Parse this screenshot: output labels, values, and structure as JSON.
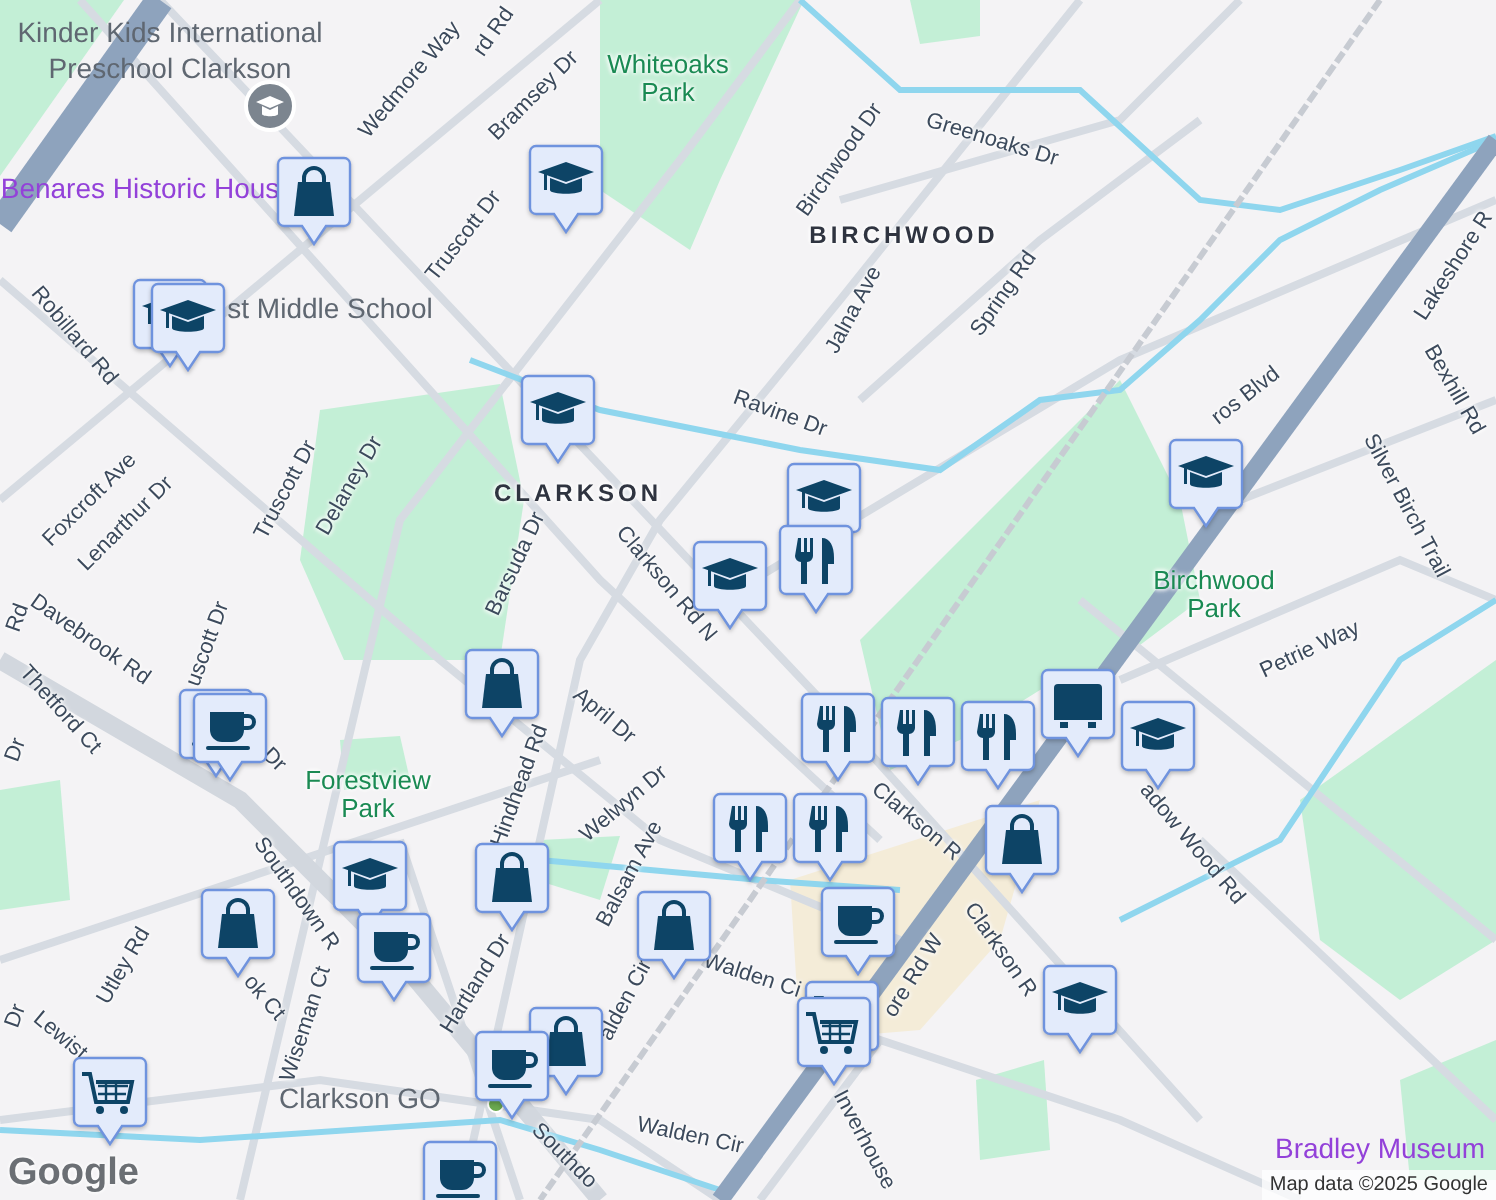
{
  "map": {
    "labels": [
      {
        "text": "Kinder Kids International Preschool Clarkson",
        "kind": "poi"
      },
      {
        "text": "rd Rd",
        "kind": "road"
      },
      {
        "text": "Wedmore Way",
        "kind": "road"
      },
      {
        "text": "Bramsey Dr",
        "kind": "road"
      },
      {
        "text": "Whiteoaks Park",
        "kind": "park"
      },
      {
        "text": "Benares Historic Hous",
        "kind": "landmark"
      },
      {
        "text": "Truscott Dr",
        "kind": "road"
      },
      {
        "text": "st Middle School",
        "kind": "poi"
      },
      {
        "text": "Robillard Rd",
        "kind": "road"
      },
      {
        "text": "Foxcroft Ave",
        "kind": "road"
      },
      {
        "text": "Lenarthur Dr",
        "kind": "road"
      },
      {
        "text": "Truscott Dr",
        "kind": "road"
      },
      {
        "text": "Delaney Dr",
        "kind": "road"
      },
      {
        "text": "CLARKSON",
        "kind": "area"
      },
      {
        "text": "Barsuda Dr",
        "kind": "road"
      },
      {
        "text": "Clarkson Rd N",
        "kind": "road"
      },
      {
        "text": "Birchwood Dr",
        "kind": "road"
      },
      {
        "text": "Greenoaks Dr",
        "kind": "road"
      },
      {
        "text": "BIRCHWOOD",
        "kind": "area"
      },
      {
        "text": "Jalna Ave",
        "kind": "road"
      },
      {
        "text": "Spring Rd",
        "kind": "road"
      },
      {
        "text": "Ravine Dr",
        "kind": "road"
      },
      {
        "text": "ros Blvd",
        "kind": "road"
      },
      {
        "text": "Lakeshore R",
        "kind": "road"
      },
      {
        "text": "Bexhill Rd",
        "kind": "road"
      },
      {
        "text": "Silver Birch Trail",
        "kind": "road"
      },
      {
        "text": "Birchwood Park",
        "kind": "park"
      },
      {
        "text": "Petrie Way",
        "kind": "road"
      },
      {
        "text": "Clarkson R",
        "kind": "road"
      },
      {
        "text": "adow Wood Rd",
        "kind": "road"
      },
      {
        "text": "ore Rd W",
        "kind": "road"
      },
      {
        "text": "Clarkson R",
        "kind": "road"
      },
      {
        "text": "Inverhouse",
        "kind": "road"
      },
      {
        "text": "Bradley Museum",
        "kind": "landmark"
      },
      {
        "text": "Rd",
        "kind": "road"
      },
      {
        "text": "Davebrook Rd",
        "kind": "road"
      },
      {
        "text": "uscott Dr",
        "kind": "road"
      },
      {
        "text": "Thetford Ct",
        "kind": "road"
      },
      {
        "text": "Dr",
        "kind": "road"
      },
      {
        "text": "Dr",
        "kind": "road"
      },
      {
        "text": "Forestview Park",
        "kind": "park"
      },
      {
        "text": "April Dr",
        "kind": "road"
      },
      {
        "text": "Hindhead Rd",
        "kind": "road"
      },
      {
        "text": "Welwyn Dr",
        "kind": "road"
      },
      {
        "text": "Southdown R",
        "kind": "road"
      },
      {
        "text": "Utley Rd",
        "kind": "road"
      },
      {
        "text": "ok Ct",
        "kind": "road"
      },
      {
        "text": "Wiseman Ct",
        "kind": "road"
      },
      {
        "text": "Hartland Dr",
        "kind": "road"
      },
      {
        "text": "Balsam Ave",
        "kind": "road"
      },
      {
        "text": "alden Cir",
        "kind": "road"
      },
      {
        "text": "Walden Ci",
        "kind": "road"
      },
      {
        "text": "Lewist",
        "kind": "road"
      },
      {
        "text": "Dr",
        "kind": "road"
      },
      {
        "text": "Clarkson GO",
        "kind": "poi"
      },
      {
        "text": "Southdo",
        "kind": "road"
      },
      {
        "text": "Walden Cir",
        "kind": "road"
      }
    ],
    "markers": [
      {
        "kind": "shopping"
      },
      {
        "kind": "school"
      },
      {
        "kind": "school"
      },
      {
        "kind": "school"
      },
      {
        "kind": "school"
      },
      {
        "kind": "school"
      },
      {
        "kind": "restaurant"
      },
      {
        "kind": "school"
      },
      {
        "kind": "school"
      },
      {
        "kind": "shopping"
      },
      {
        "kind": "coffee"
      },
      {
        "kind": "coffee"
      },
      {
        "kind": "transit"
      },
      {
        "kind": "school"
      },
      {
        "kind": "restaurant"
      },
      {
        "kind": "restaurant"
      },
      {
        "kind": "restaurant"
      },
      {
        "kind": "shopping"
      },
      {
        "kind": "restaurant"
      },
      {
        "kind": "restaurant"
      },
      {
        "kind": "coffee"
      },
      {
        "kind": "grocery"
      },
      {
        "kind": "grocery"
      },
      {
        "kind": "school"
      },
      {
        "kind": "school"
      },
      {
        "kind": "coffee"
      },
      {
        "kind": "shopping"
      },
      {
        "kind": "shopping"
      },
      {
        "kind": "shopping"
      },
      {
        "kind": "shopping"
      },
      {
        "kind": "coffee"
      },
      {
        "kind": "grocery"
      },
      {
        "kind": "coffee"
      }
    ],
    "logo": "Google",
    "attribution": "Map data ©2025 Google"
  }
}
